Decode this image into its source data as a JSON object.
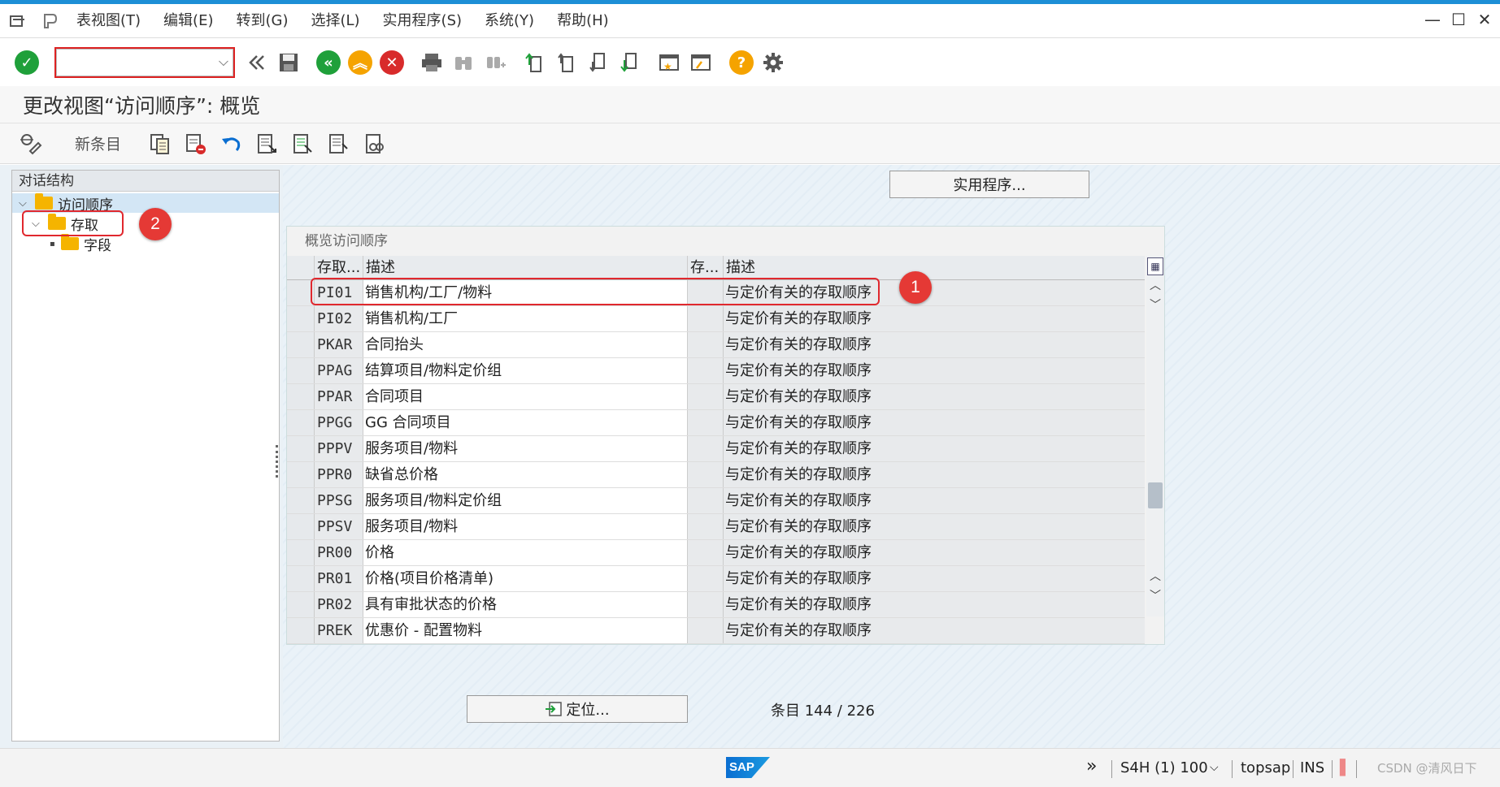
{
  "menu": {
    "items": [
      "表视图(T)",
      "编辑(E)",
      "转到(G)",
      "选择(L)",
      "实用程序(S)",
      "系统(Y)",
      "帮助(H)"
    ]
  },
  "toolbar": {
    "command_value": ""
  },
  "title": "更改视图“访问顺序”: 概览",
  "app_toolbar": {
    "new_entries": "新条目"
  },
  "tree": {
    "header": "对话结构",
    "nodes": [
      {
        "label": "访问顺序",
        "level": 0,
        "expanded": true,
        "selected": true
      },
      {
        "label": "存取",
        "level": 1,
        "expanded": true
      },
      {
        "label": "字段",
        "level": 2
      }
    ]
  },
  "utilities_button": "实用程序...",
  "table": {
    "title": "概览访问顺序",
    "columns": [
      "存取...",
      "描述",
      "存...",
      "描述"
    ],
    "rows": [
      {
        "key": "PI01",
        "desc": "销售机构/工厂/物料",
        "adesc": "与定价有关的存取顺序"
      },
      {
        "key": "PI02",
        "desc": "销售机构/工厂",
        "adesc": "与定价有关的存取顺序"
      },
      {
        "key": "PKAR",
        "desc": "合同抬头",
        "adesc": "与定价有关的存取顺序"
      },
      {
        "key": "PPAG",
        "desc": "结算项目/物料定价组",
        "adesc": "与定价有关的存取顺序"
      },
      {
        "key": "PPAR",
        "desc": "合同项目",
        "adesc": "与定价有关的存取顺序"
      },
      {
        "key": "PPGG",
        "desc": "GG 合同项目",
        "adesc": "与定价有关的存取顺序"
      },
      {
        "key": "PPPV",
        "desc": "服务项目/物料",
        "adesc": "与定价有关的存取顺序"
      },
      {
        "key": "PPR0",
        "desc": "缺省总价格",
        "adesc": "与定价有关的存取顺序"
      },
      {
        "key": "PPSG",
        "desc": "服务项目/物料定价组",
        "adesc": "与定价有关的存取顺序"
      },
      {
        "key": "PPSV",
        "desc": "服务项目/物料",
        "adesc": "与定价有关的存取顺序"
      },
      {
        "key": "PR00",
        "desc": "价格",
        "adesc": "与定价有关的存取顺序"
      },
      {
        "key": "PR01",
        "desc": "价格(项目价格清单)",
        "adesc": "与定价有关的存取顺序"
      },
      {
        "key": "PR02",
        "desc": "具有审批状态的价格",
        "adesc": "与定价有关的存取顺序"
      },
      {
        "key": "PREK",
        "desc": "优惠价 - 配置物料",
        "adesc": "与定价有关的存取顺序"
      }
    ]
  },
  "position_button": "定位...",
  "entry_count": "条目 144 / 226",
  "status": {
    "logo": "SAP",
    "system": "S4H (1) 100",
    "host": "topsap",
    "mode": "INS",
    "watermark": "CSDN @清风日下"
  },
  "annotations": [
    "1",
    "2"
  ],
  "colors": {
    "accent": "#1d8fd6",
    "annotation": "#e53935",
    "ok_green": "#1fa03a",
    "nav_orange": "#f5a300"
  }
}
